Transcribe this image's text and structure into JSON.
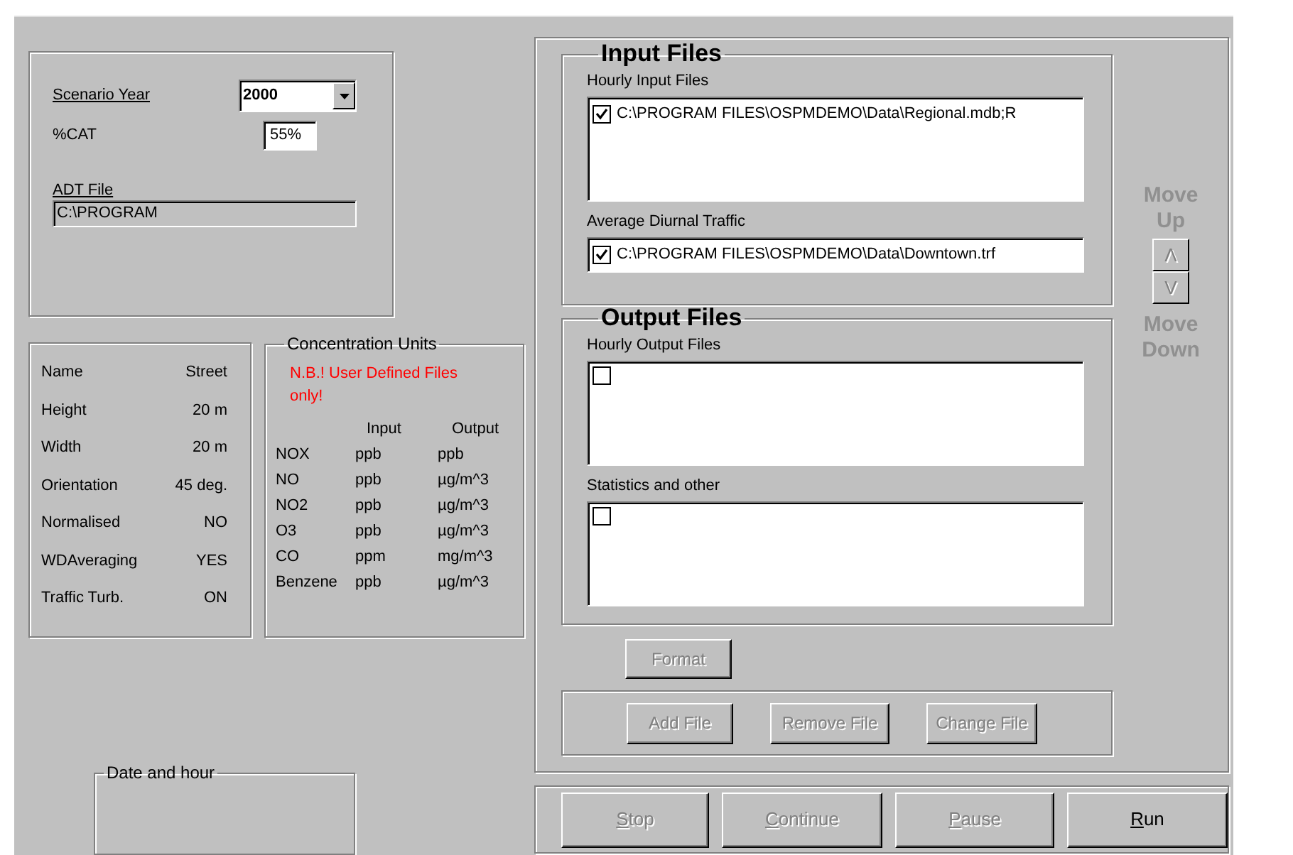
{
  "scenario": {
    "year_label": "Scenario Year",
    "year_value": "2000",
    "cat_label": "%CAT",
    "cat_value": "55%",
    "adt_label": "ADT File",
    "adt_value": "C:\\PROGRAM"
  },
  "street": [
    {
      "label": "Name",
      "value": "Street"
    },
    {
      "label": "Height",
      "value": "20 m"
    },
    {
      "label": "Width",
      "value": "20 m"
    },
    {
      "label": "Orientation",
      "value": "45 deg."
    },
    {
      "label": "Normalised",
      "value": "NO"
    },
    {
      "label": "WDAveraging",
      "value": "YES"
    },
    {
      "label": "Traffic Turb.",
      "value": "ON"
    }
  ],
  "units": {
    "title": "Concentration Units",
    "note": "N.B.!  User Defined Files only!",
    "columns": [
      "Input",
      "Output"
    ],
    "rows": [
      {
        "name": "NOX",
        "input": "ppb",
        "output": "ppb"
      },
      {
        "name": "NO",
        "input": "ppb",
        "output": "µg/m^3"
      },
      {
        "name": "NO2",
        "input": "ppb",
        "output": "µg/m^3"
      },
      {
        "name": "O3",
        "input": "ppb",
        "output": "µg/m^3"
      },
      {
        "name": "CO",
        "input": "ppm",
        "output": "mg/m^3"
      },
      {
        "name": "Benzene",
        "input": "ppb",
        "output": "µg/m^3"
      }
    ]
  },
  "date_box": {
    "title": "Date and hour"
  },
  "file_groups": [
    {
      "title": "Input Files",
      "lists": [
        {
          "label": "Hourly Input Files",
          "kind": "tall",
          "items": [
            {
              "path": "C:\\PROGRAM FILES\\OSPMDEMO\\Data\\Regional.mdb;R",
              "checked": true
            }
          ]
        },
        {
          "label": "Average Diurnal Traffic",
          "kind": "single",
          "items": [
            {
              "path": "C:\\PROGRAM FILES\\OSPMDEMO\\Data\\Downtown.trf",
              "checked": true
            }
          ]
        }
      ]
    },
    {
      "title": "Output Files",
      "lists": [
        {
          "label": "Hourly Output Files",
          "kind": "tall",
          "items": [
            {
              "checked": false
            }
          ]
        },
        {
          "label": "Statistics and other",
          "kind": "tall",
          "items": [
            {
              "checked": false
            }
          ]
        }
      ]
    }
  ],
  "move": {
    "up_label": "Move Up",
    "down_label": "Move Down",
    "up_button": "Λ",
    "down_button": "V",
    "disabled": true
  },
  "format_button": {
    "label": "Format",
    "disabled": true
  },
  "file_buttons": [
    {
      "label": "Add File",
      "disabled": true
    },
    {
      "label": "Remove File",
      "disabled": true
    },
    {
      "label": "Change File",
      "disabled": true
    }
  ],
  "run_buttons": [
    {
      "label": "Stop",
      "disabled": true
    },
    {
      "label": "Continue",
      "disabled": true
    },
    {
      "label": "Pause",
      "disabled": true
    },
    {
      "label": "Run",
      "disabled": false
    }
  ]
}
